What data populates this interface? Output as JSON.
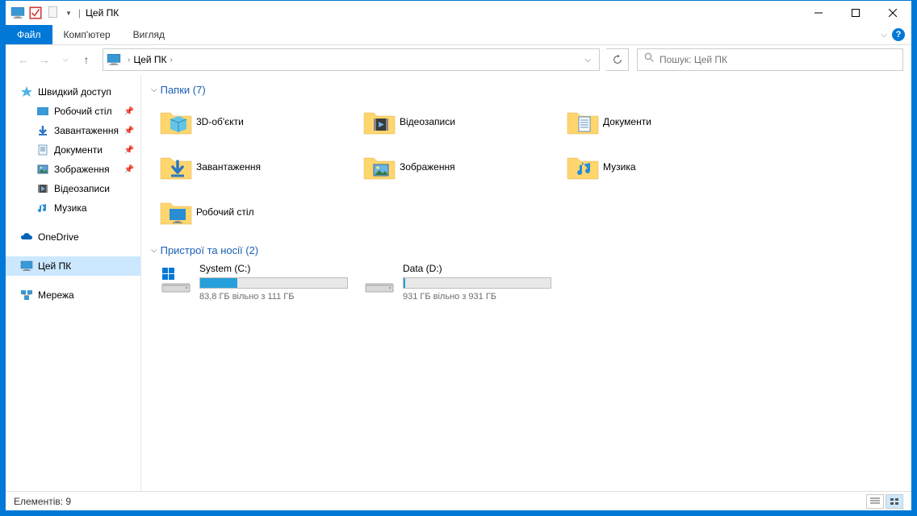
{
  "window": {
    "title": "Цей ПК"
  },
  "ribbon": {
    "file": "Файл",
    "tabs": [
      "Комп'ютер",
      "Вигляд"
    ]
  },
  "nav": {
    "breadcrumb": "Цей ПК",
    "search_placeholder": "Пошук: Цей ПК"
  },
  "sidebar": {
    "quick_access": "Швидкий доступ",
    "quick_items": [
      {
        "label": "Робочий стіл",
        "icon": "desktop"
      },
      {
        "label": "Завантаження",
        "icon": "download"
      },
      {
        "label": "Документи",
        "icon": "documents"
      },
      {
        "label": "Зображення",
        "icon": "pictures"
      },
      {
        "label": "Відеозаписи",
        "icon": "videos"
      },
      {
        "label": "Музика",
        "icon": "music"
      }
    ],
    "onedrive": "OneDrive",
    "this_pc": "Цей ПК",
    "network": "Мережа"
  },
  "groups": {
    "folders": {
      "title": "Папки (7)",
      "items": [
        {
          "label": "3D-об'єкти",
          "icon": "3d"
        },
        {
          "label": "Відеозаписи",
          "icon": "videos"
        },
        {
          "label": "Документи",
          "icon": "documents"
        },
        {
          "label": "Завантаження",
          "icon": "download"
        },
        {
          "label": "Зображення",
          "icon": "pictures"
        },
        {
          "label": "Музика",
          "icon": "music"
        },
        {
          "label": "Робочий стіл",
          "icon": "desktop"
        }
      ]
    },
    "drives": {
      "title": "Пристрої та носії (2)",
      "items": [
        {
          "name": "System (C:)",
          "free": "83,8 ГБ вільно з 111 ГБ",
          "fill_pct": 25,
          "os": true
        },
        {
          "name": "Data (D:)",
          "free": "931 ГБ вільно з 931 ГБ",
          "fill_pct": 1,
          "os": false
        }
      ]
    }
  },
  "statusbar": {
    "text": "Елементів: 9"
  }
}
